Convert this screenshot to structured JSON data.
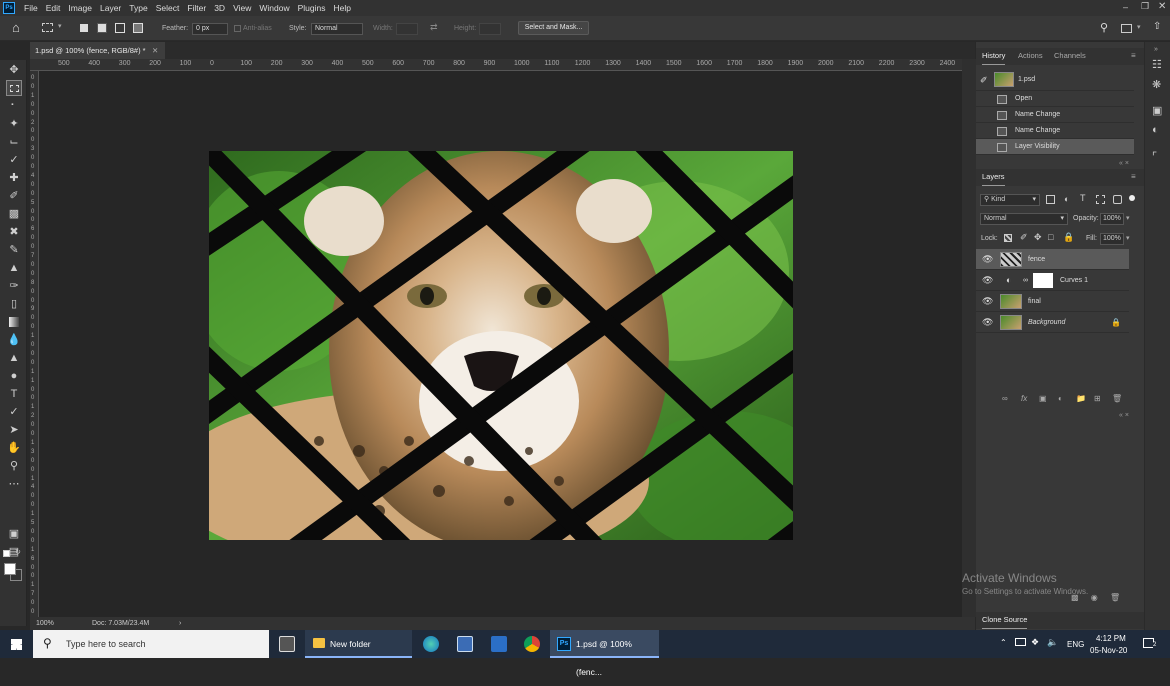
{
  "app": {
    "logo": "Ps",
    "window_controls": [
      "minimize-icon",
      "restore-icon",
      "close-icon"
    ]
  },
  "menu": [
    "File",
    "Edit",
    "Image",
    "Layer",
    "Type",
    "Select",
    "Filter",
    "3D",
    "View",
    "Window",
    "Plugins",
    "Help"
  ],
  "options": {
    "feather_label": "Feather:",
    "feather_value": "0 px",
    "antialias_label": "Anti-alias",
    "style_label": "Style:",
    "style_value": "Normal",
    "width_label": "Width:",
    "height_label": "Height:",
    "select_mask_label": "Select and Mask..."
  },
  "document": {
    "tab_title": "1.psd @ 100% (fence, RGB/8#) *",
    "zoom": "100%",
    "doc_size": "Doc: 7.03M/23.4M"
  },
  "ruler_h": [
    "500",
    "400",
    "300",
    "200",
    "100",
    "0",
    "100",
    "200",
    "300",
    "400",
    "500",
    "600",
    "700",
    "800",
    "900",
    "1000",
    "1100",
    "1200",
    "1300",
    "1400",
    "1500",
    "1600",
    "1700",
    "1800",
    "1900",
    "2000",
    "2100",
    "2200",
    "2300",
    "2400"
  ],
  "ruler_v": [
    "0",
    "0",
    "1",
    "0",
    "0",
    "2",
    "0",
    "0",
    "3",
    "0",
    "0",
    "4",
    "0",
    "0",
    "5",
    "0",
    "0",
    "6",
    "0",
    "0",
    "7",
    "0",
    "0",
    "8",
    "0",
    "0",
    "9",
    "0",
    "0",
    "1",
    "0",
    "0",
    "0",
    "1",
    "1",
    "0",
    "0",
    "1",
    "2",
    "0",
    "0",
    "1",
    "3",
    "0",
    "0",
    "1",
    "4",
    "0",
    "0",
    "1",
    "5",
    "0",
    "0",
    "1",
    "6",
    "0",
    "0",
    "1",
    "7",
    "0",
    "0"
  ],
  "history": {
    "tabs": [
      "History",
      "Actions",
      "Channels"
    ],
    "snapshot": "1.psd",
    "items": [
      "Open",
      "Name Change",
      "Name Change",
      "Layer Visibility"
    ]
  },
  "layers": {
    "tab": "Layers",
    "filter_kind": "Kind",
    "blend_mode": "Normal",
    "opacity_label": "Opacity:",
    "opacity_value": "100%",
    "lock_label": "Lock:",
    "fill_label": "Fill:",
    "fill_value": "100%",
    "items": [
      {
        "name": "fence",
        "selected": true
      },
      {
        "name": "Curves 1",
        "selected": false
      },
      {
        "name": "final",
        "selected": false
      },
      {
        "name": "Background",
        "selected": false
      }
    ]
  },
  "clone_source": {
    "tab": "Clone Source"
  },
  "watermark": {
    "line1": "Activate Windows",
    "line2": "Go to Settings to activate Windows."
  },
  "taskbar": {
    "search_placeholder": "Type here to search",
    "apps": [
      "New folder",
      "1.psd @ 100% (fenc..."
    ],
    "language": "ENG",
    "time": "4:12 PM",
    "date": "05-Nov-20",
    "notification_count": "2"
  },
  "colors": {
    "accent": "#31a8ff",
    "panel": "#383838",
    "canvas": "#262626"
  }
}
